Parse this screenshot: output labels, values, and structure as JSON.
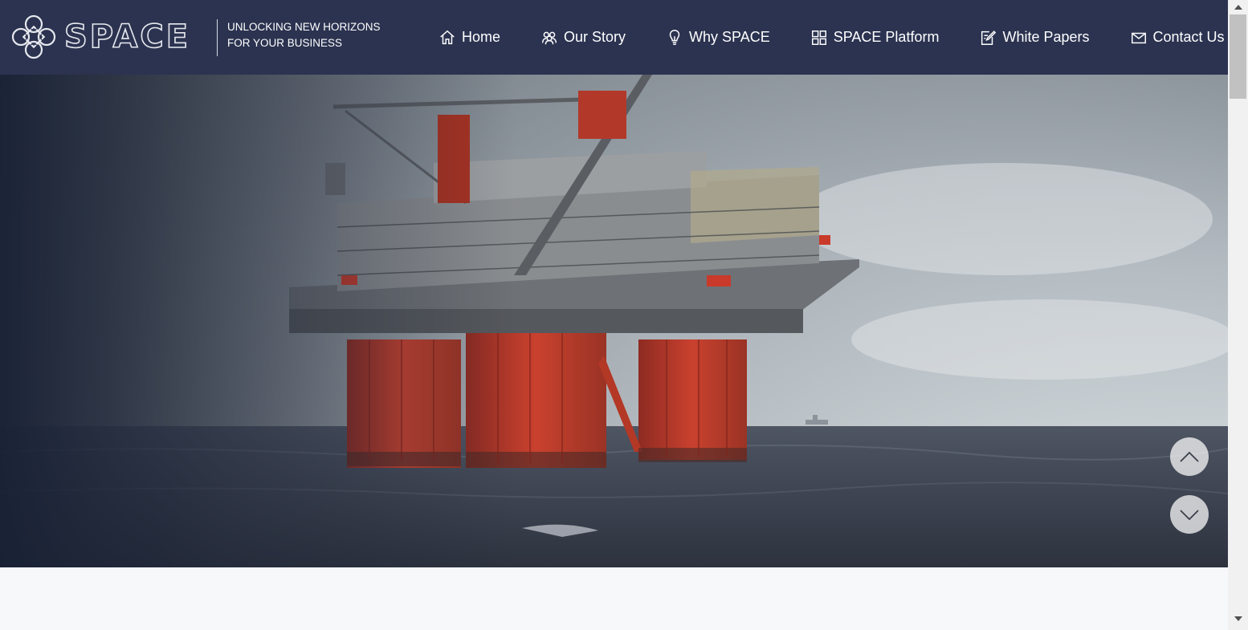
{
  "brand": {
    "name": "SPACE",
    "tagline": "UNLOCKING NEW HORIZONS FOR YOUR BUSINESS"
  },
  "nav": {
    "items": [
      {
        "label": "Home",
        "icon": "home-icon"
      },
      {
        "label": "Our Story",
        "icon": "people-icon"
      },
      {
        "label": "Why SPACE",
        "icon": "lightbulb-icon"
      },
      {
        "label": "SPACE Platform",
        "icon": "grid-icon"
      },
      {
        "label": "White Papers",
        "icon": "edit-icon"
      },
      {
        "label": "Contact Us",
        "icon": "envelope-icon"
      }
    ]
  },
  "hero": {
    "image": "offshore-oil-platform-at-sea",
    "controls": [
      "chevron-up-icon",
      "chevron-down-icon"
    ]
  },
  "colors": {
    "header_bg": "#2b3350",
    "page_bg": "#f7f8fa",
    "rig_red": "#c8321e"
  }
}
